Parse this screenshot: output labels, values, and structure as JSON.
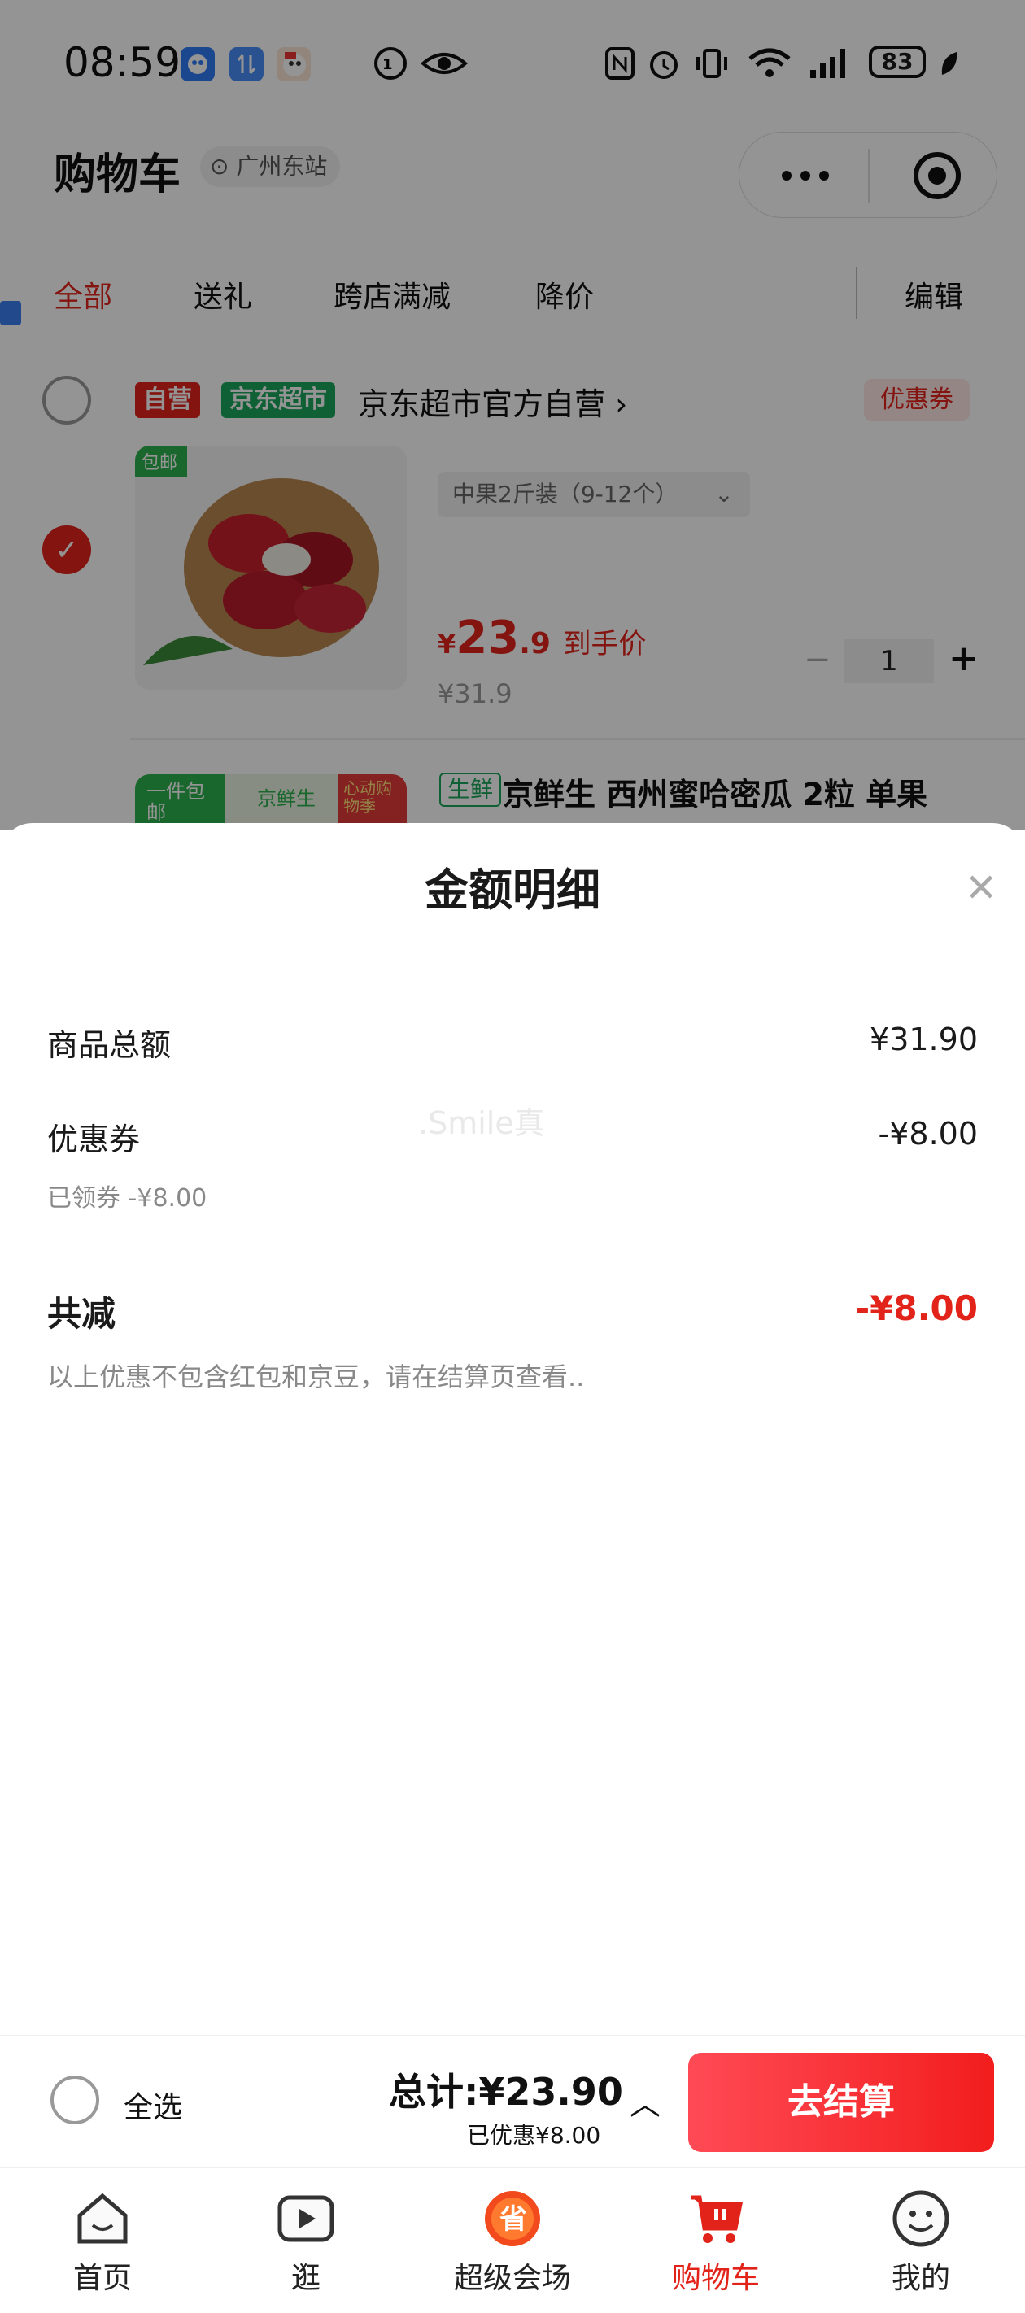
{
  "status_bar": {
    "time": "08:59",
    "battery": "83",
    "icons": [
      "bird-app-icon",
      "transfer-app-icon",
      "cartoon-app-icon",
      "signal-hd-icon",
      "eye-icon",
      "nfc-icon",
      "alarm-icon",
      "vibrate-icon",
      "wifi-icon",
      "cellular-signal-icon"
    ]
  },
  "header": {
    "title": "购物车",
    "location": "广州东站",
    "capsule_icons": [
      "more-icon",
      "target-icon"
    ]
  },
  "filter_tabs": [
    {
      "label": "全部",
      "active": true
    },
    {
      "label": "送礼",
      "active": false
    },
    {
      "label": "跨店满减",
      "active": false
    },
    {
      "label": "降价",
      "active": false
    }
  ],
  "edit_label": "编辑",
  "shop": {
    "tag_self": "自营",
    "tag_brand": "京东超市",
    "name": "京东超市官方自营",
    "coupon": "优惠券"
  },
  "item1": {
    "spec": "中果2斤装（9-12个）",
    "price_symbol": "¥",
    "price_int": "23",
    "price_dec": ".9",
    "price_note": "到手价",
    "original_price": "¥31.9",
    "qty": "1"
  },
  "item2": {
    "tag": "生鲜",
    "title": "京鲜生 西州蜜哈密瓜 2粒 单果",
    "img_text_a": "一件包邮",
    "img_text_b": "京鲜生",
    "img_text_c": "心动购物季"
  },
  "sheet": {
    "title": "金额明细",
    "rows": {
      "goods_total_label": "商品总额",
      "goods_total_value": "¥31.90",
      "coupon_label": "优惠券",
      "coupon_value": "-¥8.00",
      "coupon_sub": "已领券 -¥8.00",
      "total_reduce_label": "共减",
      "total_reduce_value": "-¥8.00",
      "note": "以上优惠不包含红包和京豆，请在结算页查看.."
    },
    "watermark": ".Smile真"
  },
  "checkout_bar": {
    "select_all": "全选",
    "total": "总计:¥23.90",
    "saved": "已优惠¥8.00",
    "button": "去结算"
  },
  "tab_bar": [
    {
      "label": "首页",
      "icon": "home-icon",
      "active": false
    },
    {
      "label": "逛",
      "icon": "video-icon",
      "active": false
    },
    {
      "label": "超级会场",
      "icon": "super-venue-icon",
      "active": false
    },
    {
      "label": "购物车",
      "icon": "cart-icon",
      "active": true
    },
    {
      "label": "我的",
      "icon": "smiley-icon",
      "active": false
    }
  ],
  "colors": {
    "accent": "#e2231a",
    "brand_green": "#1aa55b",
    "tag_red": "#e2231a"
  }
}
